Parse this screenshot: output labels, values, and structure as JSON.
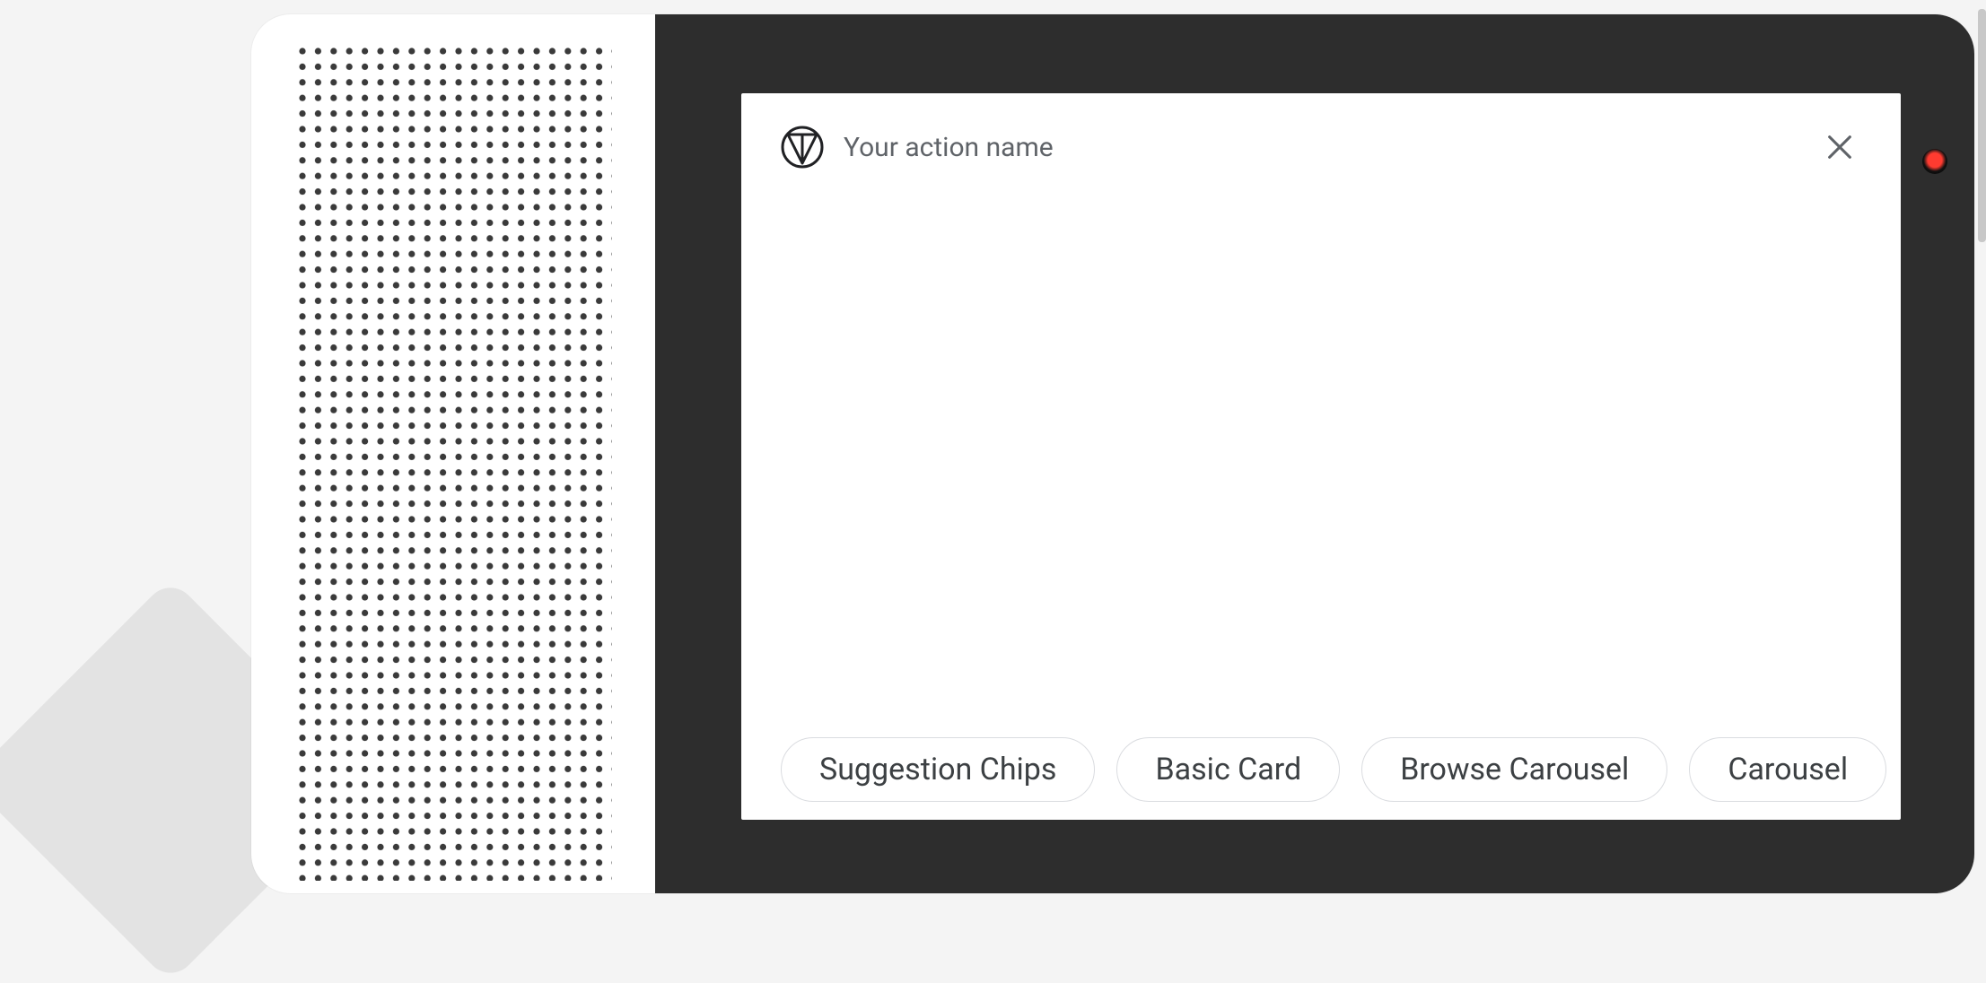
{
  "action": {
    "title": "Your action name",
    "logo_name": "material-placeholder-icon",
    "close_name": "close-icon"
  },
  "chips": [
    {
      "label": "Suggestion Chips"
    },
    {
      "label": "Basic Card"
    },
    {
      "label": "Browse Carousel"
    },
    {
      "label": "Carousel"
    }
  ],
  "device": {
    "led_name": "recording-led-icon"
  }
}
